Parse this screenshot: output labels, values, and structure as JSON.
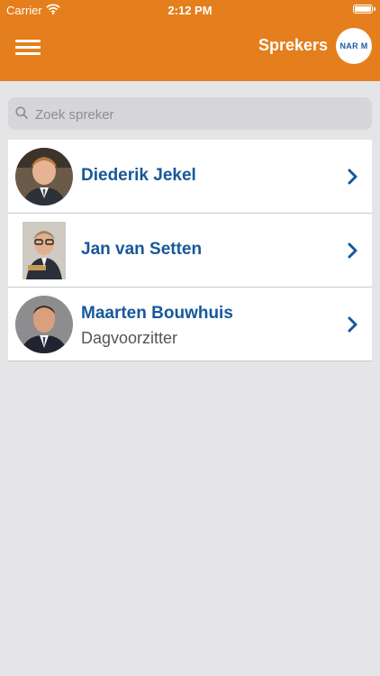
{
  "status_bar": {
    "carrier": "Carrier",
    "time": "2:12 PM"
  },
  "header": {
    "title": "Sprekers",
    "logo_text": "NAR M"
  },
  "search": {
    "placeholder": "Zoek spreker"
  },
  "speakers": [
    {
      "name": "Diederik Jekel",
      "role": ""
    },
    {
      "name": "Jan van Setten",
      "role": ""
    },
    {
      "name": "Maarten Bouwhuis",
      "role": "Dagvoorzitter"
    }
  ],
  "colors": {
    "header": "#e57e1c",
    "name_text": "#17589b",
    "background": "#e5e5e7"
  }
}
